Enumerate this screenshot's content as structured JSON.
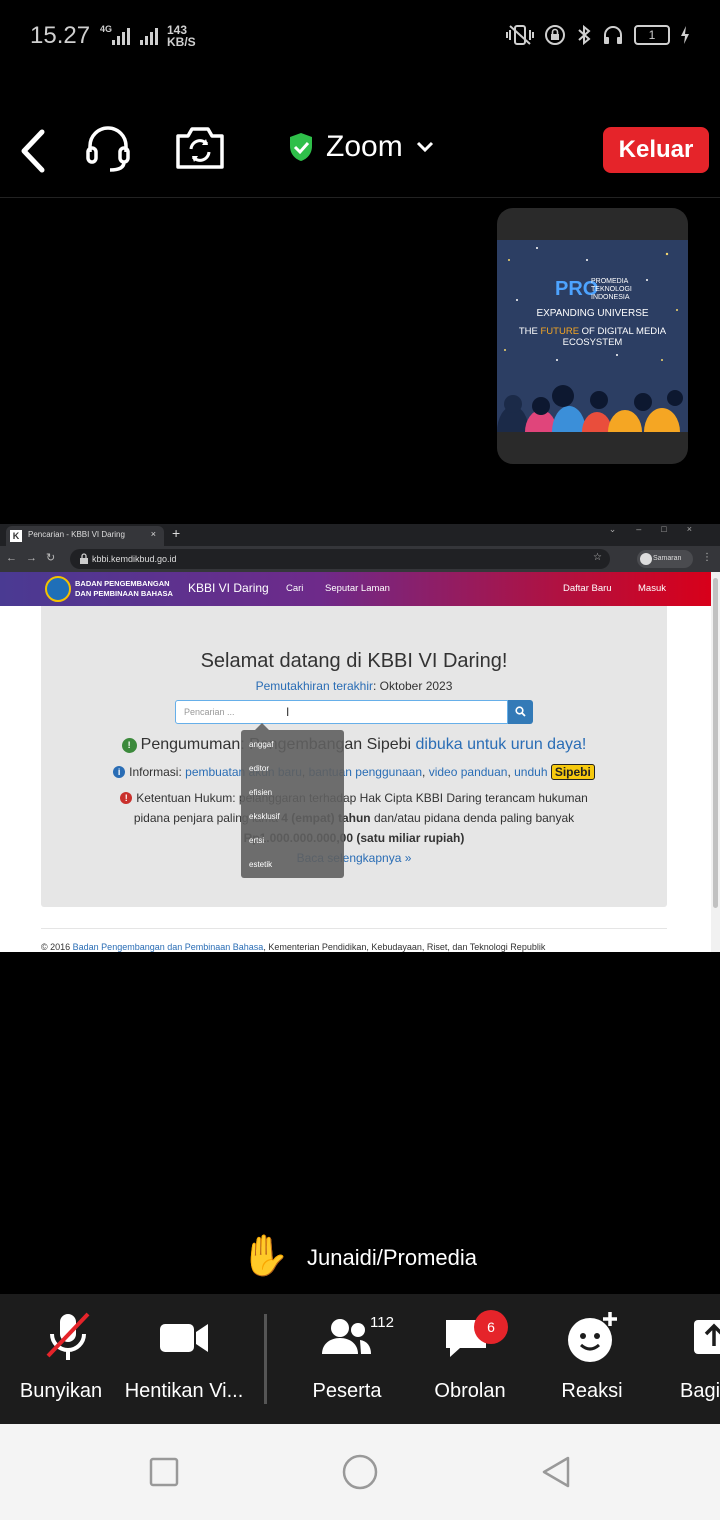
{
  "status": {
    "time": "15.27",
    "network": "4G",
    "speed_value": "143",
    "speed_unit": "KB/S",
    "battery": "1"
  },
  "zoom": {
    "title": "Zoom",
    "leave_label": "Keluar"
  },
  "thumbnail": {
    "logo": "PRO",
    "org_line1": "PROMEDIA",
    "org_line2": "TEKNOLOGI",
    "org_line3": "INDONESIA",
    "headline1": "EXPANDING UNIVERSE",
    "headline2_a": "THE ",
    "headline2_b": "FUTURE",
    "headline2_c": " OF DIGITAL MEDIA ECOSYSTEM"
  },
  "browser": {
    "tab_title": "Pencarian - KBBI VI Daring",
    "tab_close": "×",
    "new_tab": "+",
    "url": "kbbi.kemdikbud.go.id",
    "profile_name": "Samaran"
  },
  "site": {
    "org_line1": "BADAN PENGEMBANGAN",
    "org_line2": "DAN PEMBINAAN BAHASA",
    "brand": "KBBI VI Daring",
    "nav": [
      "Cari",
      "Seputar Laman",
      "Daftar Baru",
      "Masuk"
    ],
    "welcome": "Selamat datang di KBBI VI Daring!",
    "updated_label": "Pemutakhiran terakhir",
    "updated_value": ": Oktober 2023",
    "search_placeholder": "Pencarian ...",
    "announce_prefix": "Pengumuman: ",
    "announce_text": "Pengembangan Sipebi ",
    "announce_link": "dibuka untuk urun daya!",
    "info_label": "Informasi: ",
    "info_links": [
      "pembuatan akun baru",
      "bantuan penggunaan",
      "video panduan",
      "unduh"
    ],
    "sipebi": "Sipebi",
    "law_line1": "Ketentuan Hukum: pelanggaran terhadap Hak Cipta KBBI Daring terancam hukuman",
    "law_line2_a": "pidana penjara paling lama ",
    "law_line2_b": "4 (empat) tahun",
    "law_line2_c": " dan/atau pidana denda paling banyak",
    "law_line3": "Rp1.000.000.000,00 (satu miliar rupiah)",
    "read_more": "Baca selengkapnya »",
    "suggestions": [
      "anggaf",
      "editor",
      "efisien",
      "eksklusif",
      "ertsi",
      "estetik"
    ],
    "footer_prefix": "© 2016 ",
    "footer_link": "Badan Pengembangan dan Pembinaan Bahasa",
    "footer_rest": ", Kementerian Pendidikan, Kebudayaan, Riset, dan Teknologi Republik"
  },
  "raised_hand": {
    "emoji": "✋",
    "name": "Junaidi/Promedia"
  },
  "toolbar": {
    "unmute": "Bunyikan",
    "stop_video": "Hentikan Vi...",
    "participants": "Peserta",
    "participants_count": "112",
    "chat": "Obrolan",
    "chat_badge": "6",
    "reactions": "Reaksi",
    "share": "Bagi"
  },
  "colors": {
    "leave_red": "#e5242a",
    "shield_green": "#2fbf4a",
    "link_blue": "#2a6db5"
  }
}
